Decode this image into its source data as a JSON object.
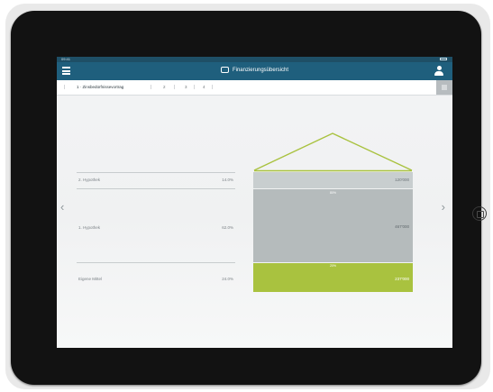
{
  "app": {
    "title": "Finanzierungsübersicht",
    "status_time": "09:41"
  },
  "tabs": [
    {
      "label": "1 · Zinsbedürfnissevortrag"
    },
    {
      "label": "2"
    },
    {
      "label": "3"
    },
    {
      "label": "4"
    }
  ],
  "nav": {
    "prev": "‹",
    "next": "›"
  },
  "rows": [
    {
      "label": "2. Hypothek",
      "percent": "14.0%"
    },
    {
      "label": "1. Hypothek",
      "percent": "62.0%"
    },
    {
      "label": "Eigene Mittel",
      "percent": "24.0%"
    }
  ],
  "blocks": [
    {
      "value": "120'000",
      "gap_label": ""
    },
    {
      "value": "467'000",
      "gap_label": "80%"
    },
    {
      "value": "237'000",
      "gap_label": "20%"
    }
  ],
  "colors": {
    "appbar": "#1f5f7d",
    "accent_green": "#a9c23f",
    "block_grey": "#b5bbbc",
    "block_light": "#c8cecf"
  }
}
